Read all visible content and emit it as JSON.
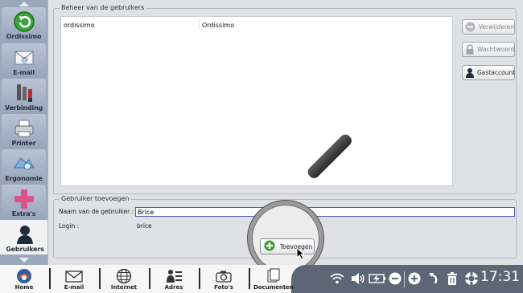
{
  "sidebar": {
    "items": [
      {
        "label": "Ordissimo",
        "icon": "back-arrow-icon"
      },
      {
        "label": "E-mail",
        "icon": "email-icon"
      },
      {
        "label": "Verbinding",
        "icon": "connection-icon"
      },
      {
        "label": "Printer",
        "icon": "printer-icon"
      },
      {
        "label": "Ergonomie",
        "icon": "ergonomics-icon"
      },
      {
        "label": "Extra's",
        "icon": "plus-icon"
      },
      {
        "label": "Gebruikers",
        "icon": "user-icon"
      }
    ],
    "active": "Gebruikers"
  },
  "users_section": {
    "title": "Beheer van de gebruikers",
    "rows": [
      {
        "login": "ordissimo",
        "name": "Ordissimo"
      }
    ],
    "buttons": {
      "delete": "Verwijderen",
      "password": "Wachtwoord",
      "guest": "Gastaccount"
    }
  },
  "add_section": {
    "title": "Gebruiker toevoegen",
    "name_label": "Naam van de gebruiker :",
    "name_value": "Brice",
    "login_label": "Login :",
    "login_value": "brice",
    "add_button": "Toevoegen"
  },
  "taskbar": {
    "items": [
      {
        "label": "Home",
        "icon": "home-icon"
      },
      {
        "label": "E-mail",
        "icon": "envelope-icon"
      },
      {
        "label": "Internet",
        "icon": "globe-icon"
      },
      {
        "label": "Adres",
        "icon": "contacts-icon"
      },
      {
        "label": "Foto's",
        "icon": "camera-icon"
      },
      {
        "label": "Documenten",
        "icon": "documents-icon"
      }
    ],
    "clock": "17:31"
  },
  "colors": {
    "sidebar_bg": "#9aa7bd",
    "panel_bg": "#dfe1e5",
    "input_border": "#5b57b6",
    "tray_bg": "#5d6675",
    "add_icon_green": "#3a9c2f"
  }
}
